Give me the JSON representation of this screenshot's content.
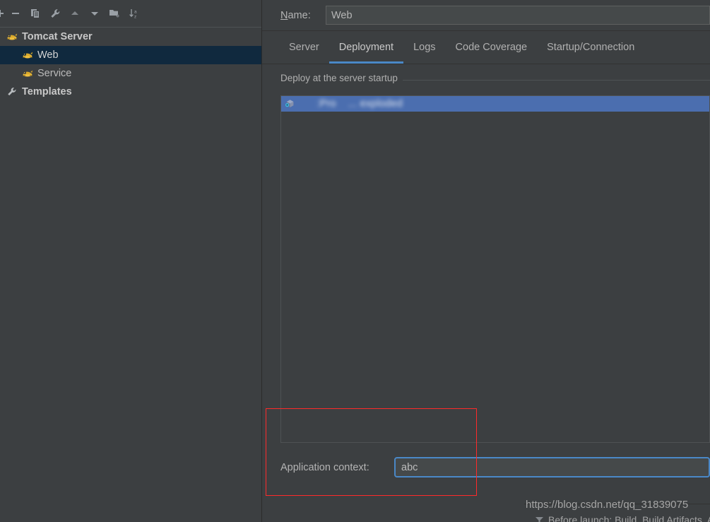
{
  "toolbar": {
    "buttons": [
      {
        "name": "add-button",
        "glyph": "+"
      },
      {
        "name": "remove-button",
        "glyph": "-"
      },
      {
        "name": "copy-button",
        "glyph": "copy"
      },
      {
        "name": "edit-configuration-templates-button",
        "glyph": "wrench"
      },
      {
        "name": "move-up-button",
        "glyph": "arrow-up"
      },
      {
        "name": "move-down-button",
        "glyph": "arrow-down"
      },
      {
        "name": "new-folder-button",
        "glyph": "folder-add"
      },
      {
        "name": "sort-configurations-button",
        "glyph": "sort-az"
      }
    ]
  },
  "tree": {
    "items": [
      {
        "label": "Tomcat Server",
        "icon": "tomcat-icon",
        "level": 0,
        "bold": true,
        "selected": false
      },
      {
        "label": "Web",
        "icon": "tomcat-icon",
        "level": 1,
        "bold": false,
        "selected": true
      },
      {
        "label": "Service",
        "icon": "tomcat-icon",
        "level": 1,
        "bold": false,
        "selected": false
      },
      {
        "label": "Templates",
        "icon": "wrench-icon",
        "level": 0,
        "bold": true,
        "selected": false
      }
    ]
  },
  "name_field": {
    "label_prefix": "N",
    "label_rest": "ame:",
    "value": "Web",
    "placeholder": "Name"
  },
  "tabs": [
    {
      "label": "Server",
      "active": false
    },
    {
      "label": "Deployment",
      "active": true
    },
    {
      "label": "Logs",
      "active": false
    },
    {
      "label": "Code Coverage",
      "active": false
    },
    {
      "label": "Startup/Connection",
      "active": false
    }
  ],
  "deployment": {
    "group_title": "Deploy at the server startup",
    "rows": [
      {
        "label": "      :Pro    ... exploded",
        "icon": "artifact-icon",
        "selected": true,
        "redacted": true
      }
    ],
    "context": {
      "label": "Application context:",
      "value": "abc",
      "placeholder": ""
    }
  },
  "before_launch": {
    "label": "Before launch: Build, Build Artifacts, Activate tool window",
    "icon": "filter-icon"
  },
  "watermark": {
    "text": "https://blog.csdn.net/qq_31839075"
  },
  "annotation": {
    "name": "red-highlight-rectangle",
    "color": "#ff2a2a"
  },
  "colors": {
    "background": "#3c3f41",
    "selection_blue": "#4b6eaf",
    "tree_selection": "#10293e",
    "accent": "#4a88c7",
    "text": "#b4b4b4"
  }
}
